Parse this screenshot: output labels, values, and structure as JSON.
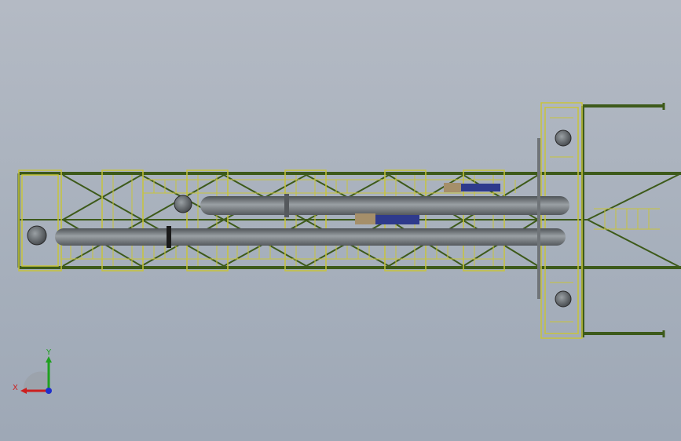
{
  "viewport": {
    "background_top": "#b4bac4",
    "background_bottom": "#9ea8b6"
  },
  "model": {
    "frame_color": "#3d5a1a",
    "rail_color": "#c8c43a",
    "vessel_color": "#6f7478",
    "vessel_highlight": "#9aa0a4",
    "pump_color": "#2e3a8c",
    "motor_color": "#a58f6a",
    "pump_casing_color": "#5e6266"
  },
  "triad": {
    "x_label": "X",
    "y_label": "Y",
    "x_color": "#cc1f1f",
    "y_color": "#1fa01f",
    "z_color": "#1f2fcc"
  }
}
